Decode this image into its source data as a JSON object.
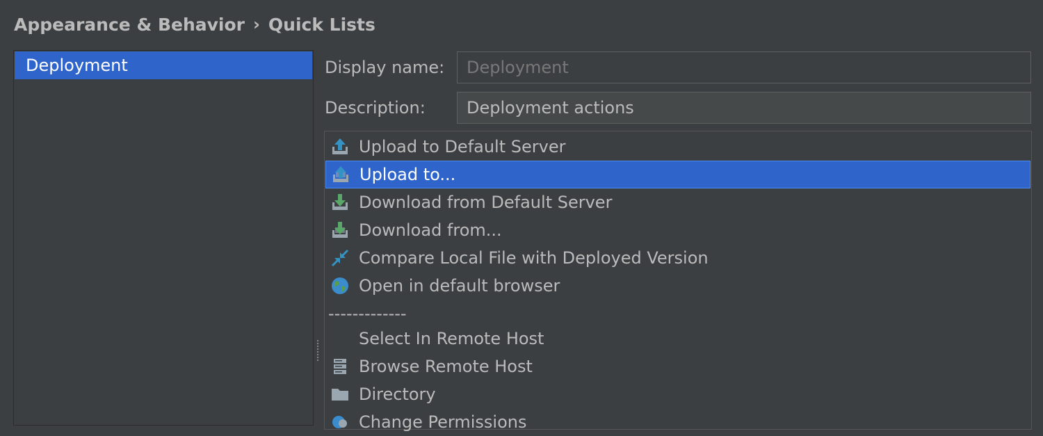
{
  "breadcrumb": {
    "parent": "Appearance & Behavior",
    "separator": "›",
    "current": "Quick Lists"
  },
  "quick_lists": {
    "items": [
      {
        "label": "Deployment",
        "selected": true
      }
    ]
  },
  "form": {
    "display_name_label": "Display name:",
    "display_name_value": "Deployment",
    "description_label": "Description:",
    "description_value": "Deployment actions"
  },
  "actions": [
    {
      "label": "Upload to Default Server",
      "icon": "upload-icon"
    },
    {
      "label": "Upload to...",
      "icon": "upload-to-icon",
      "selected": true
    },
    {
      "label": "Download from Default Server",
      "icon": "download-icon"
    },
    {
      "label": "Download from...",
      "icon": "download-from-icon"
    },
    {
      "label": "Compare Local File with Deployed Version",
      "icon": "compare-icon"
    },
    {
      "label": "Open in default browser",
      "icon": "globe-icon"
    },
    {
      "label": "-------------",
      "separator": true
    },
    {
      "label": "Select In Remote Host",
      "icon": ""
    },
    {
      "label": "Browse Remote Host",
      "icon": "server-icon"
    },
    {
      "label": "Directory",
      "icon": "folder-icon"
    },
    {
      "label": "Change Permissions",
      "icon": "permissions-icon"
    }
  ],
  "colors": {
    "background": "#3c3f41",
    "selection": "#2f65ca",
    "text": "#bbbbbb"
  }
}
